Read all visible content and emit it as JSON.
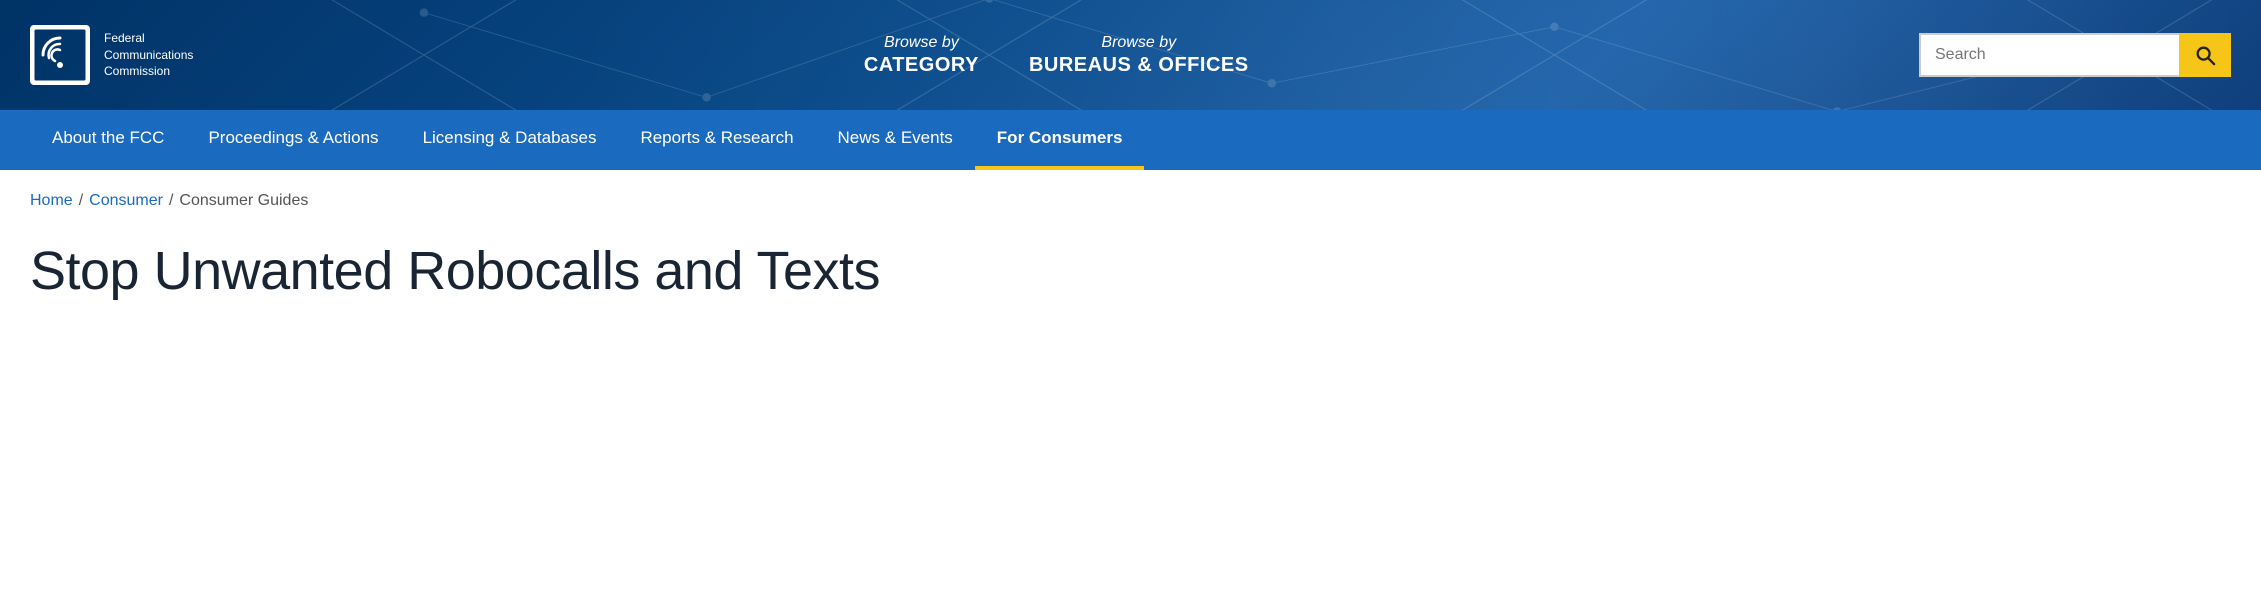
{
  "header": {
    "logo_text": "FCC",
    "logo_subtitle_line1": "Federal",
    "logo_subtitle_line2": "Communications",
    "logo_subtitle_line3": "Commission",
    "browse_category_prefix": "Browse by",
    "browse_category_label": "CATEGORY",
    "browse_bureaus_prefix": "Browse by",
    "browse_bureaus_label": "BUREAUS & OFFICES",
    "search_placeholder": "Search"
  },
  "nav": {
    "items": [
      {
        "label": "About the FCC",
        "id": "about",
        "active": false
      },
      {
        "label": "Proceedings & Actions",
        "id": "proceedings",
        "active": false
      },
      {
        "label": "Licensing & Databases",
        "id": "licensing",
        "active": false
      },
      {
        "label": "Reports & Research",
        "id": "reports",
        "active": false
      },
      {
        "label": "News & Events",
        "id": "news",
        "active": false
      },
      {
        "label": "For Consumers",
        "id": "consumers",
        "active": true
      }
    ]
  },
  "breadcrumb": {
    "home": "Home",
    "consumer": "Consumer",
    "current": "Consumer Guides"
  },
  "page": {
    "title": "Stop Unwanted Robocalls and Texts"
  },
  "colors": {
    "header_bg": "#0a3d6e",
    "nav_bg": "#1a6abf",
    "search_btn": "#f5c518",
    "active_underline": "#f5c518",
    "link_color": "#1a6abf",
    "title_color": "#1a2533"
  }
}
